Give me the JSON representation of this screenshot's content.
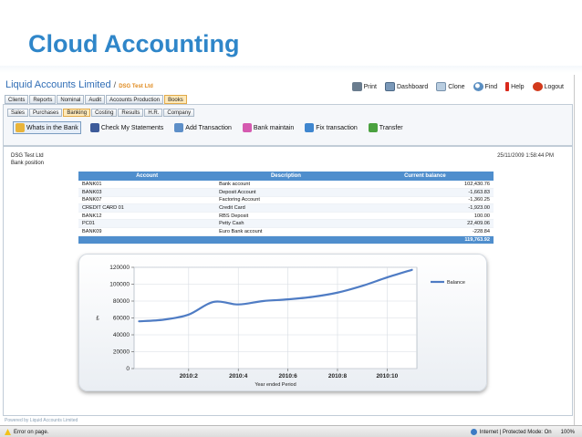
{
  "slide": {
    "title": "Cloud Accounting"
  },
  "header": {
    "company": "Liquid Accounts Limited",
    "separator": "/",
    "client": "DSG Test Ltd"
  },
  "toolbar": {
    "items": [
      {
        "label": "Print",
        "icon": "print-icon"
      },
      {
        "label": "Dashboard",
        "icon": "dashboard-icon"
      },
      {
        "label": "Clone",
        "icon": "clone-icon"
      },
      {
        "label": "Find",
        "icon": "find-icon"
      },
      {
        "label": "Help",
        "icon": "help-icon"
      },
      {
        "label": "Logout",
        "icon": "logout-icon"
      }
    ]
  },
  "main_tabs": [
    {
      "label": "Clients"
    },
    {
      "label": "Reports"
    },
    {
      "label": "Nominal"
    },
    {
      "label": "Audit"
    },
    {
      "label": "Accounts Production"
    },
    {
      "label": "Books",
      "active": true
    }
  ],
  "sub_tabs": [
    {
      "label": "Sales"
    },
    {
      "label": "Purchases"
    },
    {
      "label": "Banking",
      "active": true
    },
    {
      "label": "Costing"
    },
    {
      "label": "Results"
    },
    {
      "label": "H.R."
    },
    {
      "label": "Company"
    }
  ],
  "actions": [
    {
      "label": "Whats in the Bank",
      "icon": "bank-folder-icon",
      "color": "#e9b43a",
      "active": true
    },
    {
      "label": "Check My Statements",
      "icon": "statement-icon",
      "color": "#3d5b9a"
    },
    {
      "label": "Add Transaction",
      "icon": "add-transaction-icon",
      "color": "#5d8fc8"
    },
    {
      "label": "Bank maintain",
      "icon": "bank-maintain-icon",
      "color": "#d55ab0"
    },
    {
      "label": "Fix transaction",
      "icon": "fix-transaction-icon",
      "color": "#3f86cf"
    },
    {
      "label": "Transfer",
      "icon": "transfer-icon",
      "color": "#4aa13f"
    }
  ],
  "panel": {
    "company": "DSG Test Ltd",
    "subtitle": "Bank position",
    "timestamp": "25/11/2009 1:58:44 PM"
  },
  "table": {
    "headers": {
      "account": "Account",
      "description": "Description",
      "balance": "Current balance"
    },
    "rows": [
      {
        "account": "BANK01",
        "description": "Bank account",
        "balance": "102,430.76"
      },
      {
        "account": "BANK03",
        "description": "Deposit Account",
        "balance": "-1,663.83"
      },
      {
        "account": "BANK07",
        "description": "Factoring Account",
        "balance": "-1,360.25"
      },
      {
        "account": "CREDIT CARD 01",
        "description": "Credit Card",
        "balance": "-1,923.00"
      },
      {
        "account": "BANK12",
        "description": "RBS Deposit",
        "balance": "100.00"
      },
      {
        "account": "PC01",
        "description": "Petty Cash",
        "balance": "22,409.06"
      },
      {
        "account": "BANK09",
        "description": "Euro Bank account",
        "balance": "-228.84"
      }
    ],
    "total": "119,763.92"
  },
  "chart_data": {
    "type": "line",
    "xlabel": "Year ended Period",
    "ylabel": "£",
    "ylim": [
      0,
      120000
    ],
    "yticks": [
      0,
      20000,
      40000,
      60000,
      80000,
      100000,
      120000
    ],
    "ytick_labels": [
      "0",
      "20000",
      "40000",
      "60000",
      "80000",
      "100000",
      "120000"
    ],
    "xticks": [
      2,
      4,
      6,
      8,
      10
    ],
    "xtick_labels": [
      "2010:2",
      "2010:4",
      "2010:6",
      "2010:8",
      "2010:10"
    ],
    "xlim": [
      -0.2,
      11.2
    ],
    "grid": true,
    "legend": "top-right",
    "series": [
      {
        "name": "Balance",
        "color": "#4f7cc4",
        "x": [
          0,
          1,
          2,
          3,
          4,
          5,
          6,
          7,
          8,
          9,
          10,
          11
        ],
        "values": [
          56000,
          58000,
          64000,
          79000,
          76000,
          80000,
          82000,
          85000,
          90000,
          98000,
          108000,
          117000
        ]
      }
    ]
  },
  "footer": {
    "text": "Powered by Liquid Accounts Limited"
  },
  "statusbar": {
    "left": "Error on page.",
    "zone": "Internet | Protected Mode: On",
    "zoom": "100%"
  }
}
